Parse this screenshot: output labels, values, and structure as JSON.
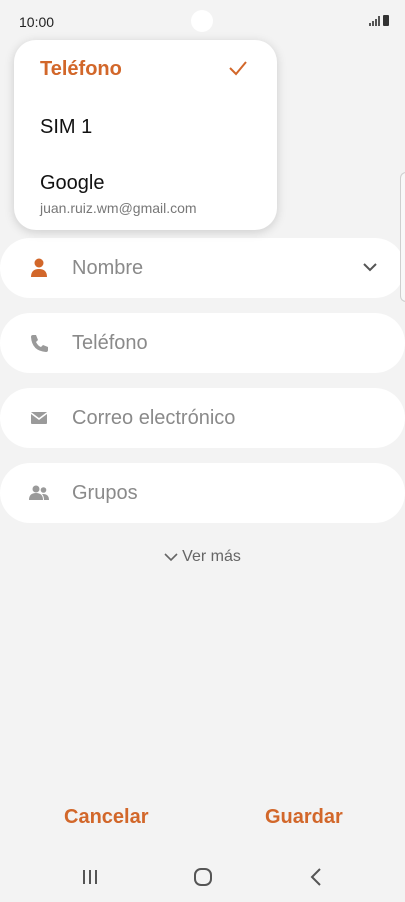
{
  "status_bar": {
    "time": "10:00"
  },
  "dropdown": {
    "selected_label": "Teléfono",
    "items": [
      {
        "label": "SIM 1"
      },
      {
        "label": "Google",
        "sublabel": "juan.ruiz.wm@gmail.com"
      }
    ]
  },
  "form": {
    "name_field": "Nombre",
    "phone_field": "Teléfono",
    "email_field": "Correo electrónico",
    "groups_field": "Grupos",
    "more_label": "Ver más"
  },
  "actions": {
    "cancel": "Cancelar",
    "save": "Guardar"
  },
  "colors": {
    "accent": "#d2672a",
    "background": "#f3f3f3",
    "card": "#ffffff",
    "icon_gray": "#9a9a9a"
  },
  "icons": [
    "person-icon",
    "phone-icon",
    "email-icon",
    "groups-icon",
    "chevron-down-icon",
    "check-icon",
    "recent-apps-icon",
    "home-icon",
    "back-icon"
  ]
}
